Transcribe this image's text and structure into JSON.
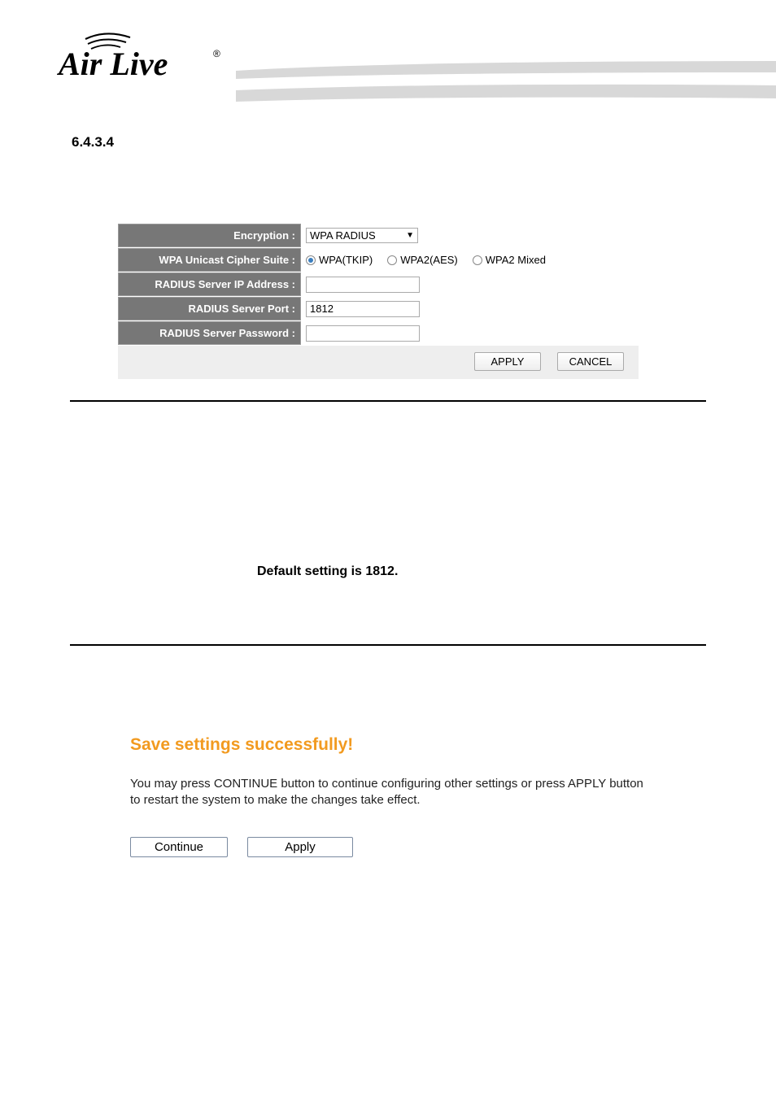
{
  "logo_text": "Air Live",
  "section_number": "6.4.3.4",
  "form": {
    "rows": {
      "encryption": {
        "label": "Encryption :",
        "value": "WPA RADIUS"
      },
      "cipher": {
        "label": "WPA Unicast Cipher Suite :",
        "options": {
          "a": "WPA(TKIP)",
          "b": "WPA2(AES)",
          "c": "WPA2 Mixed"
        }
      },
      "ip": {
        "label": "RADIUS Server IP Address :",
        "value": ""
      },
      "port": {
        "label": "RADIUS Server Port :",
        "value": "1812"
      },
      "password": {
        "label": "RADIUS Server Password :",
        "value": ""
      }
    },
    "buttons": {
      "apply": "APPLY",
      "cancel": "CANCEL"
    }
  },
  "note": "Default setting is 1812.",
  "save": {
    "title": "Save settings successfully!",
    "text": "You may press CONTINUE button to continue configuring other settings or press APPLY button to restart the system to make the changes take effect.",
    "continue": "Continue",
    "apply": "Apply"
  }
}
